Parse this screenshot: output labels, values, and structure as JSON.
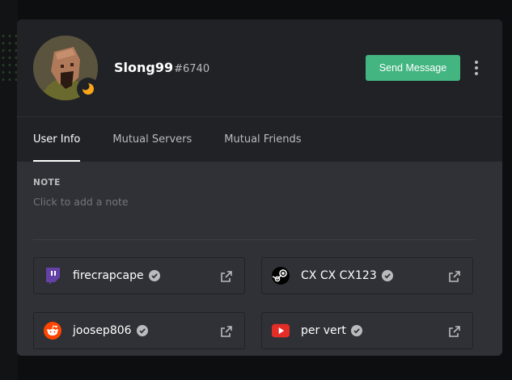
{
  "profile": {
    "username": "Slong99",
    "discriminator": "#6740",
    "status_icon": "moon-idle-icon",
    "colors": {
      "status_idle": "#faa61a",
      "send_button": "#43b581"
    }
  },
  "actions": {
    "send_message_label": "Send Message",
    "more_icon": "vertical-dots-icon"
  },
  "tabs": [
    {
      "label": "User Info",
      "active": true
    },
    {
      "label": "Mutual Servers",
      "active": false
    },
    {
      "label": "Mutual Friends",
      "active": false
    }
  ],
  "note": {
    "label": "NOTE",
    "placeholder": "Click to add a note"
  },
  "accounts": [
    {
      "service": "twitch",
      "icon": "twitch-icon",
      "name": "firecrapcape",
      "verified": true
    },
    {
      "service": "steam",
      "icon": "steam-icon",
      "name": "CX CX CX123",
      "verified": true
    },
    {
      "service": "reddit",
      "icon": "reddit-icon",
      "name": "joosep806",
      "verified": true
    },
    {
      "service": "youtube",
      "icon": "youtube-icon",
      "name": "per vert",
      "verified": true
    }
  ]
}
